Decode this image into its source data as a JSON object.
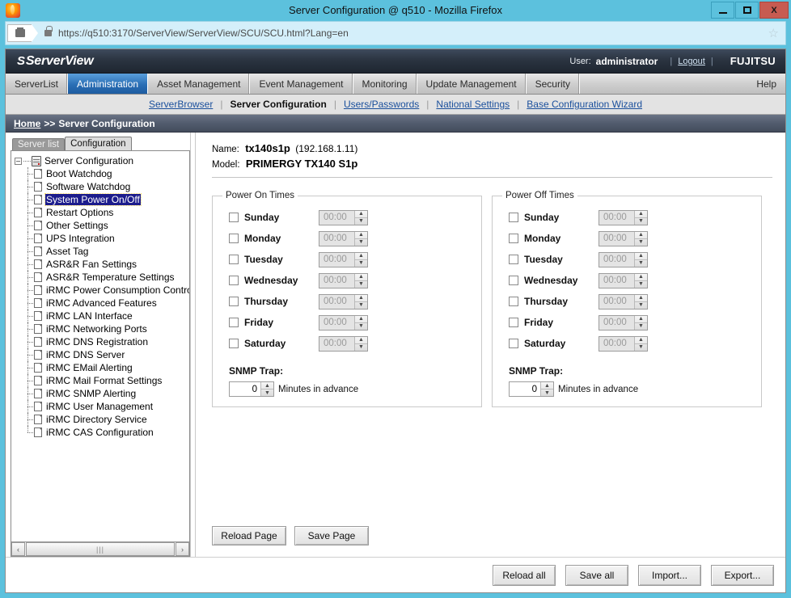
{
  "window": {
    "title": "Server Configuration @ q510 - Mozilla Firefox",
    "minimize_label": "–",
    "maximize_label": "□",
    "close_label": "X"
  },
  "browser": {
    "url": "https://q510:3170/ServerView/ServerView/SCU/SCU.html?Lang=en",
    "bookmark_icon": "☆"
  },
  "header": {
    "logo_mark": "S",
    "logo_text": "ServerView",
    "user_label": "User:",
    "user_name": "administrator",
    "logout_label": "Logout",
    "brand": "FUJITSU"
  },
  "main_tabs": [
    {
      "label": "ServerList",
      "active": false
    },
    {
      "label": "Administration",
      "active": true
    },
    {
      "label": "Asset Management",
      "active": false
    },
    {
      "label": "Event Management",
      "active": false
    },
    {
      "label": "Monitoring",
      "active": false
    },
    {
      "label": "Update Management",
      "active": false
    },
    {
      "label": "Security",
      "active": false
    }
  ],
  "help_tab": {
    "label": "Help"
  },
  "subnav": [
    {
      "label": "ServerBrowser",
      "current": false
    },
    {
      "label": "Server Configuration",
      "current": true
    },
    {
      "label": "Users/Passwords",
      "current": false
    },
    {
      "label": "National Settings",
      "current": false
    },
    {
      "label": "Base Configuration Wizard",
      "current": false
    }
  ],
  "breadcrumb": {
    "home": "Home",
    "separator": ">>",
    "current": "Server Configuration"
  },
  "tree_tabs": [
    {
      "label": "Server list",
      "active": false
    },
    {
      "label": "Configuration",
      "active": true
    }
  ],
  "tree": {
    "expander": "–",
    "root": "Server Configuration",
    "items": [
      "Boot Watchdog",
      "Software Watchdog",
      "System Power On/Off",
      "Restart Options",
      "Other Settings",
      "UPS Integration",
      "Asset Tag",
      "ASR&R Fan Settings",
      "ASR&R Temperature Settings",
      "iRMC Power Consumption Control",
      "iRMC Advanced Features",
      "iRMC LAN Interface",
      "iRMC Networking Ports",
      "iRMC DNS Registration",
      "iRMC DNS Server",
      "iRMC EMail Alerting",
      "iRMC Mail Format Settings",
      "iRMC SNMP Alerting",
      "iRMC User Management",
      "iRMC Directory Service",
      "iRMC CAS Configuration"
    ],
    "selected": "System Power On/Off"
  },
  "scrollbar": {
    "left_arrow": "‹",
    "right_arrow": "›",
    "grip": "|||"
  },
  "server_info": {
    "name_label": "Name:",
    "name_value": "tx140s1p",
    "name_ip": "(192.168.1.11)",
    "model_label": "Model:",
    "model_value": "PRIMERGY TX140 S1p"
  },
  "power_on": {
    "legend": "Power On Times",
    "days": [
      {
        "label": "Sunday",
        "checked": false,
        "time": "00:00",
        "disabled": true
      },
      {
        "label": "Monday",
        "checked": false,
        "time": "00:00",
        "disabled": true
      },
      {
        "label": "Tuesday",
        "checked": false,
        "time": "00:00",
        "disabled": true
      },
      {
        "label": "Wednesday",
        "checked": false,
        "time": "00:00",
        "disabled": true
      },
      {
        "label": "Thursday",
        "checked": false,
        "time": "00:00",
        "disabled": true
      },
      {
        "label": "Friday",
        "checked": false,
        "time": "00:00",
        "disabled": true
      },
      {
        "label": "Saturday",
        "checked": false,
        "time": "00:00",
        "disabled": true
      }
    ],
    "snmp_title": "SNMP Trap:",
    "snmp_value": "0",
    "snmp_unit": "Minutes in advance"
  },
  "power_off": {
    "legend": "Power Off Times",
    "days": [
      {
        "label": "Sunday",
        "checked": false,
        "time": "00:00",
        "disabled": true
      },
      {
        "label": "Monday",
        "checked": false,
        "time": "00:00",
        "disabled": true
      },
      {
        "label": "Tuesday",
        "checked": false,
        "time": "00:00",
        "disabled": true
      },
      {
        "label": "Wednesday",
        "checked": false,
        "time": "00:00",
        "disabled": true
      },
      {
        "label": "Thursday",
        "checked": false,
        "time": "00:00",
        "disabled": true
      },
      {
        "label": "Friday",
        "checked": false,
        "time": "00:00",
        "disabled": true
      },
      {
        "label": "Saturday",
        "checked": false,
        "time": "00:00",
        "disabled": true
      }
    ],
    "snmp_title": "SNMP Trap:",
    "snmp_value": "0",
    "snmp_unit": "Minutes in advance"
  },
  "page_buttons": [
    {
      "label": "Reload Page"
    },
    {
      "label": "Save Page"
    }
  ],
  "footer_buttons": [
    {
      "label": "Reload all"
    },
    {
      "label": "Save all"
    },
    {
      "label": "Import..."
    },
    {
      "label": "Export..."
    }
  ],
  "spinner": {
    "up": "▲",
    "down": "▼"
  },
  "colors": {
    "window_frame": "#5cc1dd",
    "accent_blue": "#2a6fb5",
    "header_dark": "#2b3441",
    "selection": "#1c1c8c",
    "close_red": "#c75b51"
  }
}
